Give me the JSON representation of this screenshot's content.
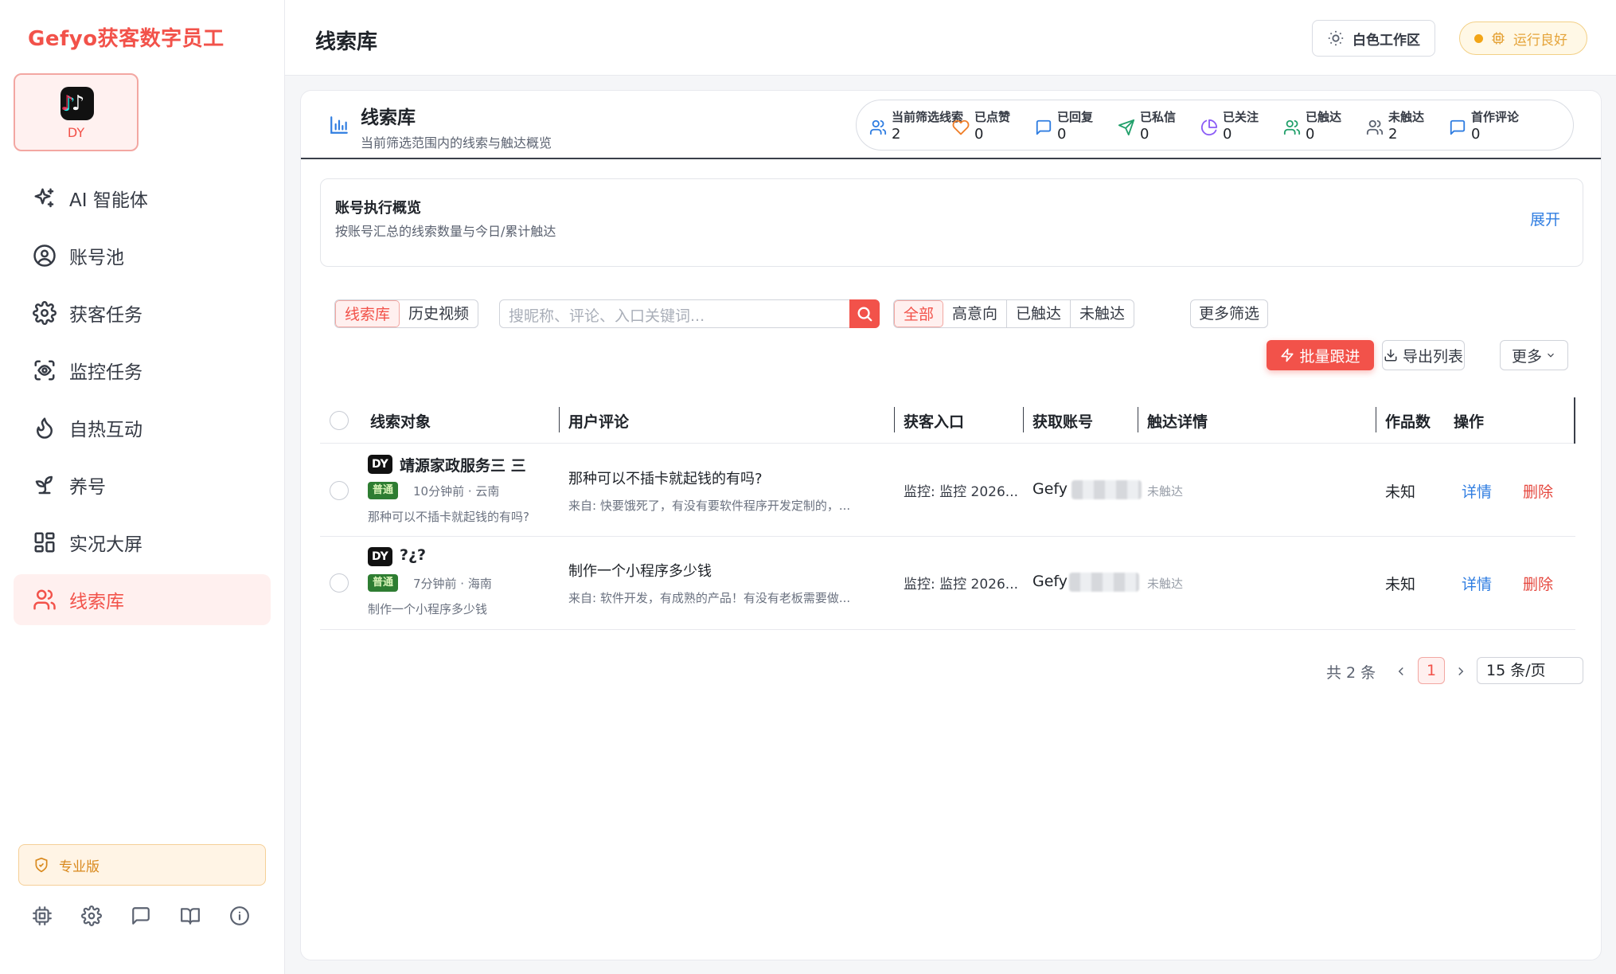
{
  "app": {
    "brand": "Gefyo获客数字员工",
    "platform": {
      "label": "DY",
      "logo_glyph": "♪"
    }
  },
  "sidebar": {
    "items": [
      {
        "label": "AI 智能体",
        "icon": "sparkles-icon",
        "active": false
      },
      {
        "label": "账号池",
        "icon": "user-circle-icon",
        "active": false
      },
      {
        "label": "获客任务",
        "icon": "gear-icon",
        "active": false
      },
      {
        "label": "监控任务",
        "icon": "scan-eye-icon",
        "active": false
      },
      {
        "label": "自热互动",
        "icon": "flame-icon",
        "active": false
      },
      {
        "label": "养号",
        "icon": "sprout-icon",
        "active": false
      },
      {
        "label": "实况大屏",
        "icon": "dashboard-grid-icon",
        "active": false
      },
      {
        "label": "线索库",
        "icon": "users-icon",
        "active": true
      }
    ],
    "edition": "专业版",
    "bottom_icons": [
      "cpu-icon",
      "settings-icon",
      "message-icon",
      "book-icon",
      "info-icon"
    ]
  },
  "header": {
    "title": "线索库",
    "theme_label": "白色工作区",
    "status_label": "运行良好"
  },
  "panel": {
    "title": "线索库",
    "subtitle": "当前筛选范围内的线索与触达概览",
    "stats": [
      {
        "label": "当前筛选线索",
        "value": "2",
        "icon": "users-icon",
        "color": "#2f7de1"
      },
      {
        "label": "已点赞",
        "value": "0",
        "icon": "heart-icon",
        "color": "#f07f2a"
      },
      {
        "label": "已回复",
        "value": "0",
        "icon": "message-icon",
        "color": "#2f7de1"
      },
      {
        "label": "已私信",
        "value": "0",
        "icon": "send-icon",
        "color": "#22a06b"
      },
      {
        "label": "已关注",
        "value": "0",
        "icon": "pie-icon",
        "color": "#8b5cf6"
      },
      {
        "label": "已触达",
        "value": "0",
        "icon": "users-icon",
        "color": "#22a06b"
      },
      {
        "label": "未触达",
        "value": "2",
        "icon": "users-icon",
        "color": "#5b6270"
      },
      {
        "label": "首作评论",
        "value": "0",
        "icon": "message-icon",
        "color": "#2f7de1"
      }
    ]
  },
  "overview": {
    "title": "账号执行概览",
    "subtitle": "按账号汇总的线索数量与今日/累计触达",
    "expand_label": "展开"
  },
  "toolbar": {
    "view_tabs": [
      {
        "label": "线索库",
        "active": true
      },
      {
        "label": "历史视频",
        "active": false
      }
    ],
    "search_placeholder": "搜昵称、评论、入口关键词...",
    "filters": [
      {
        "label": "全部",
        "active": true
      },
      {
        "label": "高意向",
        "active": false
      },
      {
        "label": "已触达",
        "active": false
      },
      {
        "label": "未触达",
        "active": false
      }
    ],
    "more_filters": "更多筛选",
    "batch_label": "批量跟进",
    "export_label": "导出列表",
    "more_label": "更多"
  },
  "table": {
    "columns": [
      "线索对象",
      "用户评论",
      "获客入口",
      "获取账号",
      "触达详情",
      "作品数",
      "操作"
    ],
    "rows": [
      {
        "platform": "DY",
        "nickname": "靖源家政服务三 三",
        "level": "普通",
        "meta": "10分钟前 · 云南",
        "preview": "那种可以不插卡就起钱的有吗?",
        "comment": "那种可以不插卡就起钱的有吗?",
        "source": "来自: 快要饿死了，有没有要软件程序开发定制的，...",
        "entry": "监控: 监控 2026...",
        "account": "Gefy",
        "reach": "未触达",
        "works": "未知",
        "detail": "详情",
        "delete": "删除"
      },
      {
        "platform": "DY",
        "nickname": "?¿?",
        "level": "普通",
        "meta": "7分钟前 · 海南",
        "preview": "制作一个小程序多少钱",
        "comment": "制作一个小程序多少钱",
        "source": "来自: 软件开发，有成熟的产品！有没有老板需要做...",
        "entry": "监控: 监控 2026...",
        "account": "Gefy",
        "reach": "未触达",
        "works": "未知",
        "detail": "详情",
        "delete": "删除"
      }
    ]
  },
  "pagination": {
    "total": "共 2 条",
    "current": "1",
    "page_size": "15 条/页"
  }
}
